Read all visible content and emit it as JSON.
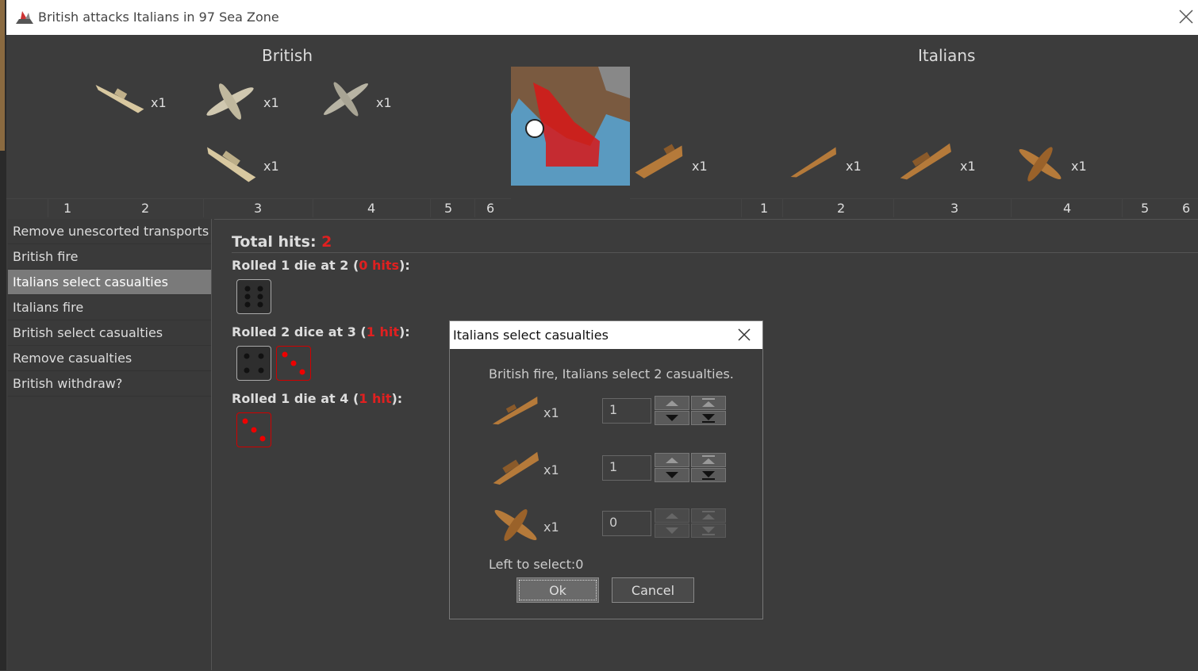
{
  "window": {
    "title": "British attacks Italians in 97 Sea Zone"
  },
  "attacker": {
    "name": "British",
    "units": [
      {
        "icon": "destroyer-icon",
        "count": "x1"
      },
      {
        "icon": "fighter-plane-icon",
        "count": "x1"
      },
      {
        "icon": "bomber-plane-icon",
        "count": "x1"
      },
      {
        "icon": "cruiser-icon",
        "count": "x1"
      }
    ],
    "dice_columns": [
      "1",
      "2",
      "3",
      "4",
      "5",
      "6"
    ]
  },
  "defender": {
    "name": "Italians",
    "units": [
      {
        "icon": "transport-ship-icon",
        "count": "x1"
      },
      {
        "icon": "destroyer-icon",
        "count": "x1"
      },
      {
        "icon": "cruiser-icon",
        "count": "x1"
      },
      {
        "icon": "fighter-plane-icon",
        "count": "x1"
      }
    ],
    "dice_columns": [
      "1",
      "2",
      "3",
      "4",
      "5",
      "6"
    ]
  },
  "steps": [
    {
      "label": "Remove unescorted transports",
      "selected": false
    },
    {
      "label": "British fire",
      "selected": false
    },
    {
      "label": "Italians select casualties",
      "selected": true
    },
    {
      "label": "Italians fire",
      "selected": false
    },
    {
      "label": "British select casualties",
      "selected": false
    },
    {
      "label": "Remove casualties",
      "selected": false
    },
    {
      "label": "British withdraw?",
      "selected": false
    }
  ],
  "results": {
    "total_label": "Total hits: ",
    "total_value": "2",
    "rolls": [
      {
        "prefix": "Rolled 1 die at 2 (",
        "hits": "0 hits",
        "suffix": "):",
        "dice": [
          6
        ]
      },
      {
        "prefix": "Rolled 2 dice at 3 (",
        "hits": "1 hit",
        "suffix": "):",
        "dice": [
          4,
          3
        ]
      },
      {
        "prefix": "Rolled 1 die at 4 (",
        "hits": "1 hit",
        "suffix": "):",
        "dice": [
          3
        ]
      }
    ]
  },
  "dialog": {
    "title": "Italians select casualties",
    "message": "British fire,  Italians select 2 casualties.",
    "rows": [
      {
        "icon": "destroyer-icon",
        "count": "x1",
        "value": "1"
      },
      {
        "icon": "cruiser-icon",
        "count": "x1",
        "value": "1"
      },
      {
        "icon": "fighter-plane-icon",
        "count": "x1",
        "value": "0"
      }
    ],
    "left_to_select": "Left to select:0",
    "ok_label": "Ok",
    "cancel_label": "Cancel"
  },
  "colors": {
    "hits_red": "#e02020",
    "british_unit": "#d8c8a0",
    "italian_unit": "#b57a3a"
  }
}
